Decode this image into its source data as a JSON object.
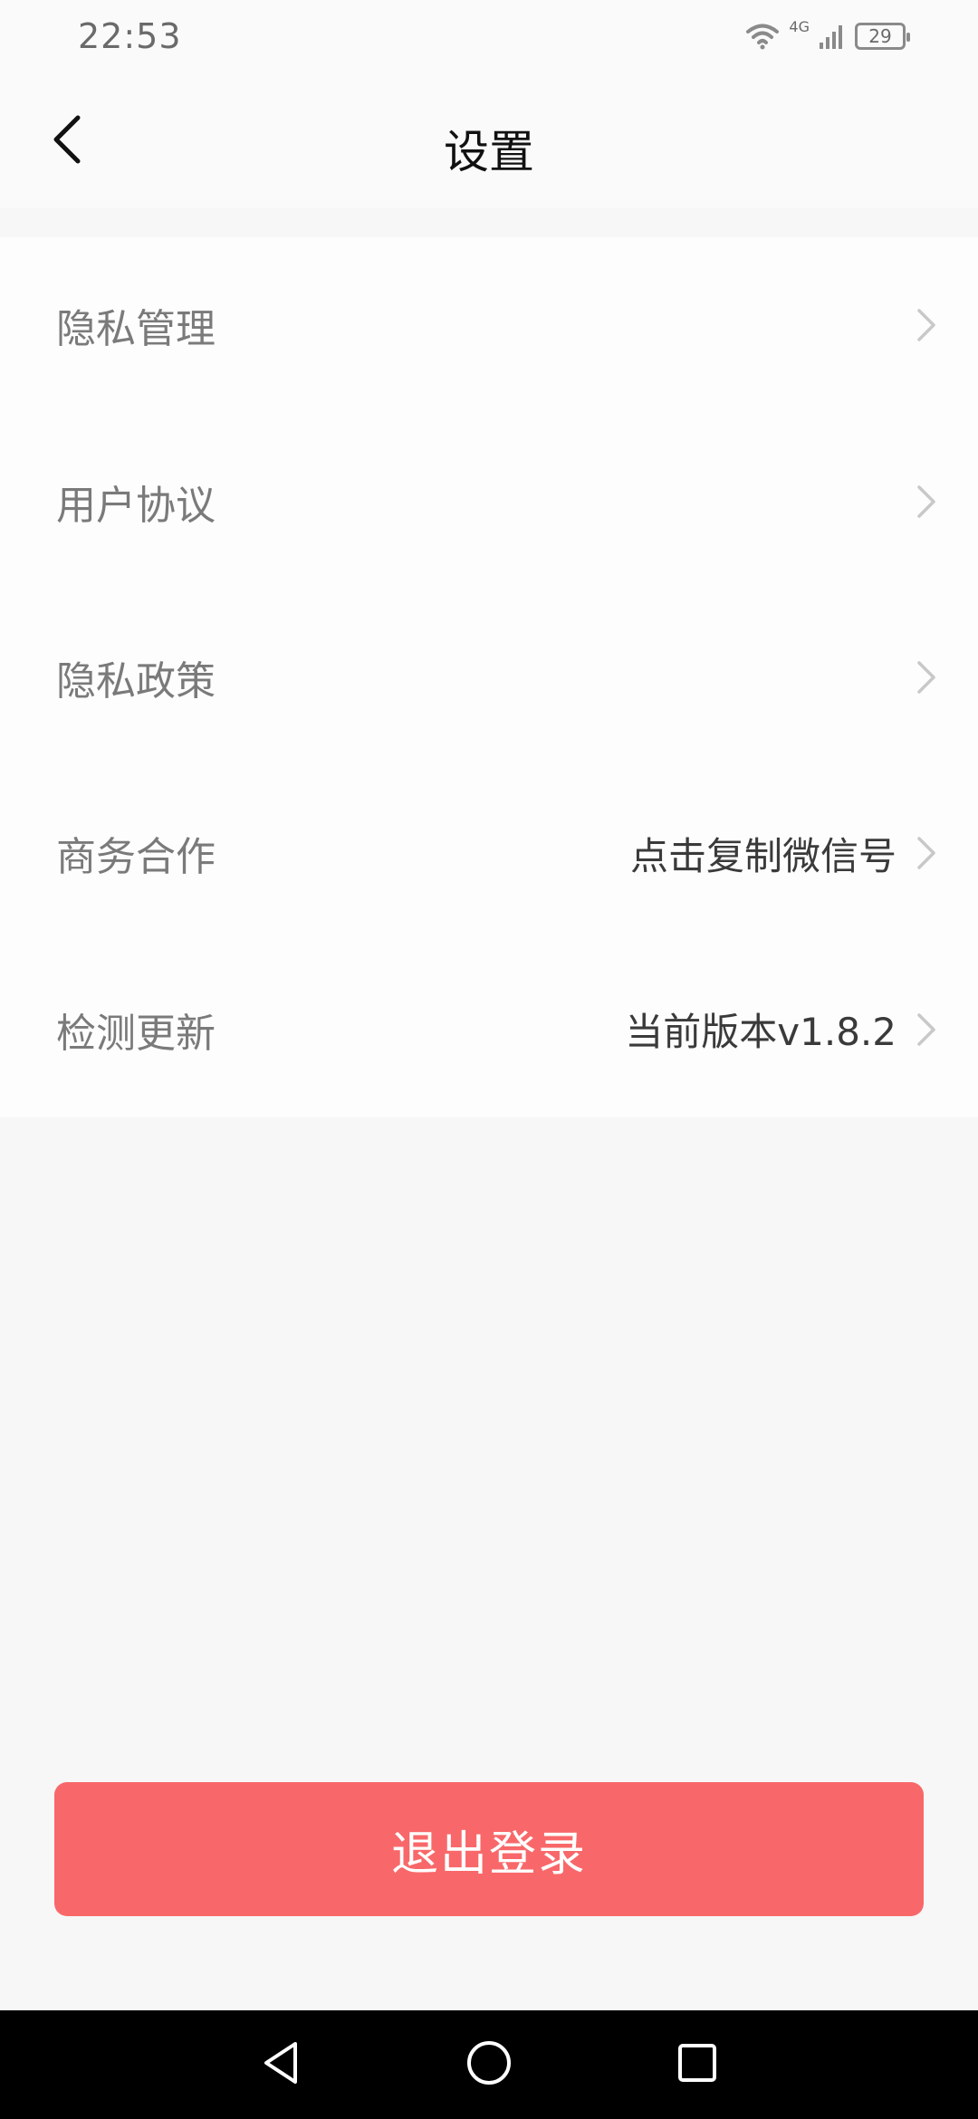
{
  "status_bar": {
    "time": "22:53",
    "network_label": "4G",
    "battery_level": "29"
  },
  "header": {
    "title": "设置"
  },
  "settings": {
    "items": [
      {
        "label": "隐私管理",
        "value": ""
      },
      {
        "label": "用户协议",
        "value": ""
      },
      {
        "label": "隐私政策",
        "value": ""
      },
      {
        "label": "商务合作",
        "value": "点击复制微信号"
      },
      {
        "label": "检测更新",
        "value": "当前版本v1.8.2"
      }
    ]
  },
  "logout": {
    "label": "退出登录"
  },
  "colors": {
    "logout_button": "#f8686a",
    "background": "#f7f7f7",
    "nav_bar": "#000000"
  },
  "icons": {
    "back": "chevron-left-icon",
    "row_arrow": "chevron-right-icon",
    "nav_back": "triangle-back-icon",
    "nav_home": "circle-home-icon",
    "nav_recents": "square-recents-icon"
  }
}
